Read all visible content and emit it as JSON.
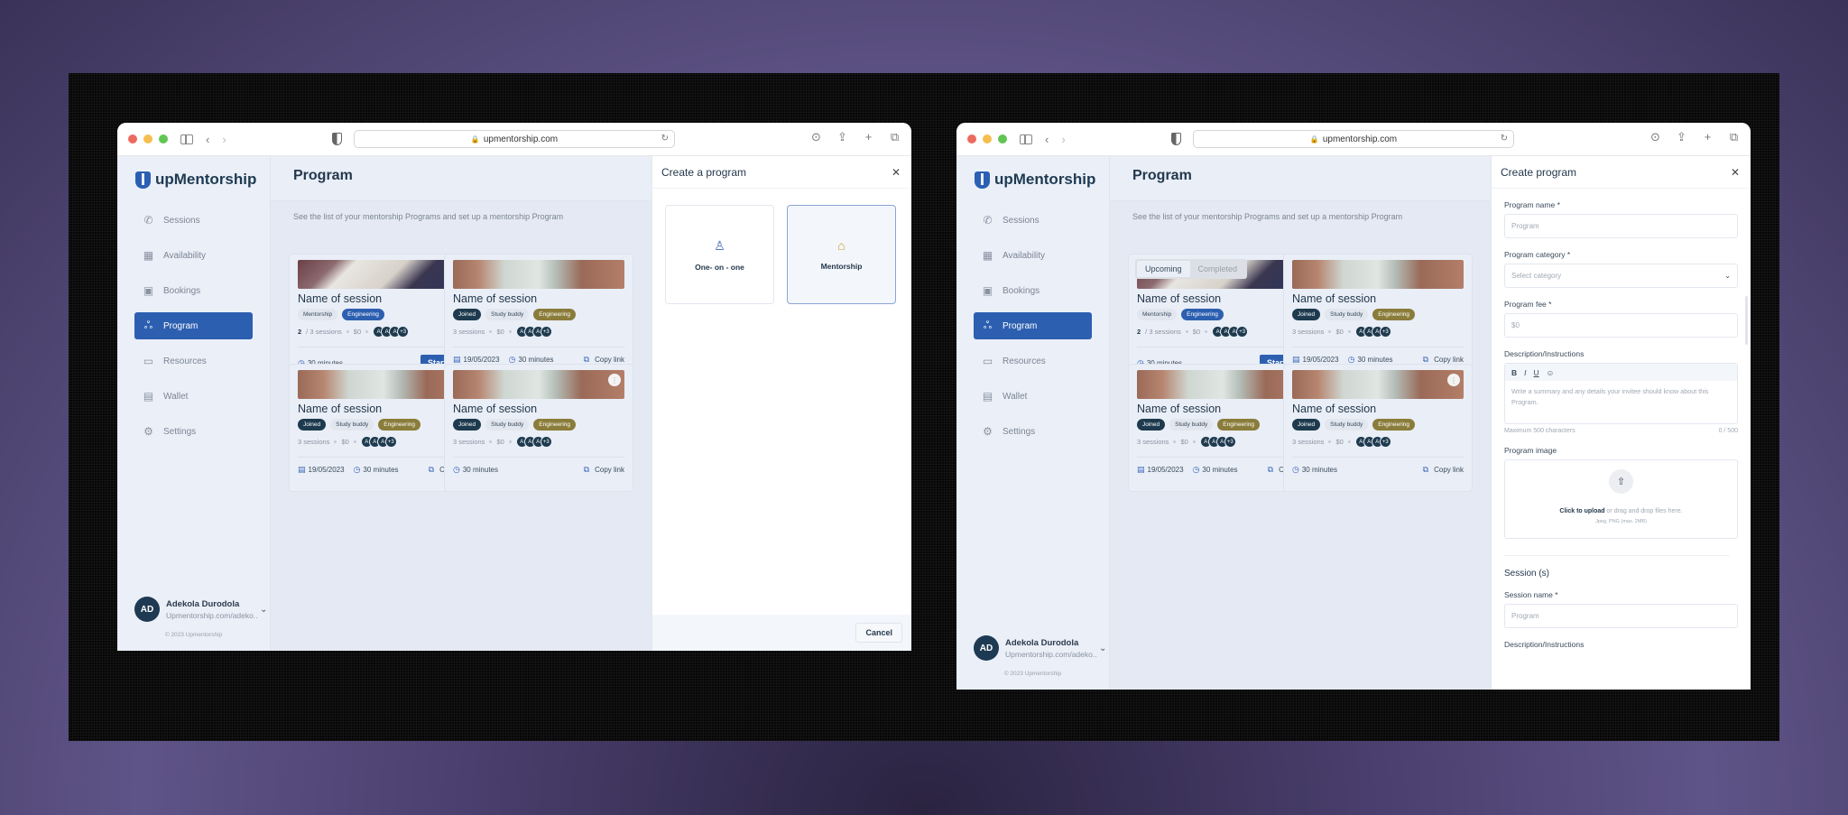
{
  "browser": {
    "url": "upmentorship.com"
  },
  "app": {
    "logo": "upMentorship",
    "page_title": "Program",
    "page_description": "See the list of your mentorship Programs and set up a mentorship Program",
    "nav": [
      {
        "label": "Sessions",
        "icon": "phone-icon"
      },
      {
        "label": "Availability",
        "icon": "calendar-icon"
      },
      {
        "label": "Bookings",
        "icon": "bookings-icon"
      },
      {
        "label": "Program",
        "icon": "people-icon",
        "active": true
      },
      {
        "label": "Resources",
        "icon": "folder-icon"
      },
      {
        "label": "Wallet",
        "icon": "wallet-icon"
      },
      {
        "label": "Settings",
        "icon": "gear-icon"
      }
    ],
    "user": {
      "initials": "AD",
      "name": "Adekola Durodola",
      "link": "Upmentorship.com/adeko..",
      "copyright": "© 2023 Upmentorship"
    },
    "cards": [
      {
        "title": "Name of session",
        "tags": [
          "Mentorship",
          "Engineering"
        ],
        "sessions_done": "2",
        "sessions_text": "/ 3 sessions",
        "price": "$0",
        "avatars": [
          "A",
          "A",
          "A",
          "+3"
        ],
        "duration": "30 minutes",
        "action": "Start call"
      },
      {
        "title": "Name of session",
        "tags": [
          "Joined",
          "Study buddy",
          "Engineering"
        ],
        "sessions_text": "3 sessions",
        "price": "$0",
        "avatars": [
          "A",
          "A",
          "A",
          "+3"
        ],
        "date": "19/05/2023",
        "duration": "30 minutes",
        "action": "Copy link"
      },
      {
        "title": "Name of session",
        "tags": [
          "Joined",
          "Study buddy",
          "Engineering"
        ],
        "sessions_text": "3 sessions",
        "price": "$0",
        "avatars": [
          "A",
          "A",
          "A",
          "+3"
        ],
        "date": "19/05/2023",
        "duration": "30 minutes",
        "action": "Copy link"
      },
      {
        "title": "Name of session",
        "tags": [
          "Joined",
          "Study buddy",
          "Engineering"
        ],
        "sessions_text": "3 sessions",
        "price": "$0",
        "avatars": [
          "A",
          "A",
          "A",
          "+3"
        ],
        "duration": "30 minutes",
        "action": "Copy link"
      }
    ],
    "tabs": [
      "Upcoming",
      "Completed"
    ]
  },
  "create_a_program": {
    "title": "Create a program",
    "options": [
      {
        "label": "One- on - one",
        "selected": false
      },
      {
        "label": "Mentorship",
        "selected": true
      }
    ],
    "cancel": "Cancel"
  },
  "create_program": {
    "title": "Create program",
    "program_name_label": "Program name *",
    "program_name_placeholder": "Program",
    "category_label": "Program category *",
    "category_placeholder": "Select category",
    "fee_label": "Program fee *",
    "fee_placeholder": "$0",
    "desc_label": "Description/Instructions",
    "desc_toolbar": [
      "B",
      "I",
      "U",
      "☺"
    ],
    "desc_placeholder": "Write a summary and any details your invitee should know about this Program.",
    "desc_hint": "Maximum 500 characters",
    "desc_count": "0 / 500",
    "image_label": "Program image",
    "upload_cta": "Click to upload",
    "upload_rest": "or drag and drop files here.",
    "upload_formats": "Jpeg, PNG (max. 2MB)",
    "sessions_heading": "Session (s)",
    "session_name_label": "Session name *",
    "session_name_placeholder": "Program",
    "session_desc_label": "Description/Instructions"
  }
}
